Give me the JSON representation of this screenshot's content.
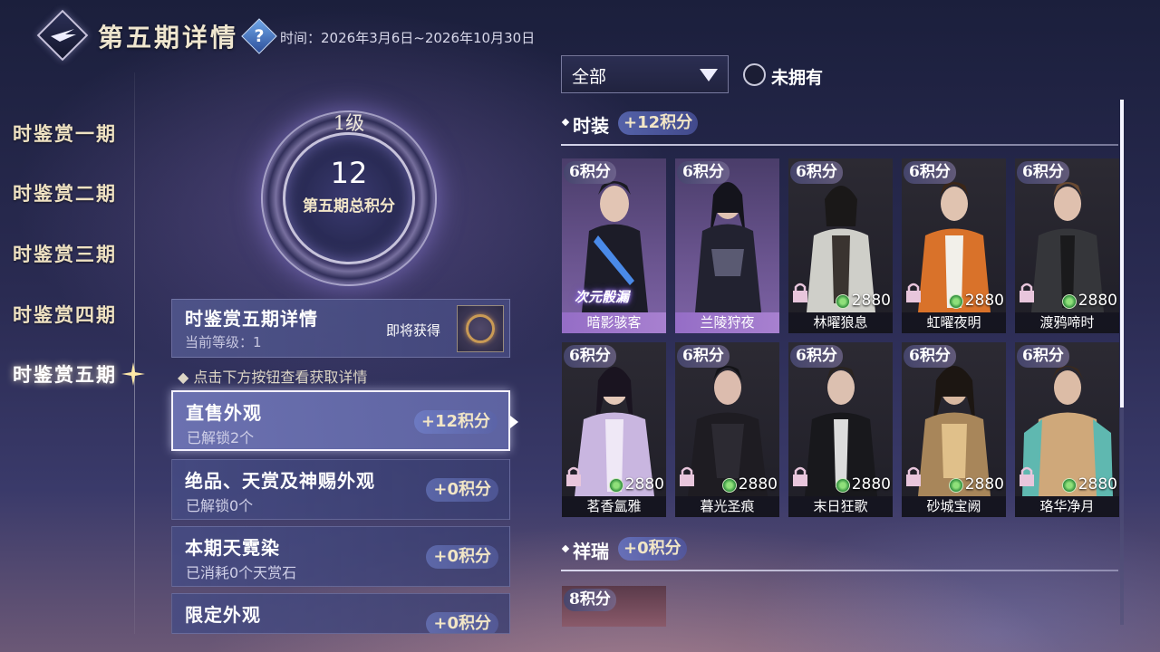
{
  "header": {
    "title": "第五期详情",
    "help_label": "?",
    "time_label": "时间：",
    "time_range": "2026年3月6日~2026年10月30日"
  },
  "nav": {
    "items": [
      {
        "label": "时鉴赏一期"
      },
      {
        "label": "时鉴赏二期"
      },
      {
        "label": "时鉴赏三期"
      },
      {
        "label": "时鉴赏四期"
      },
      {
        "label": "时鉴赏五期",
        "active": true
      }
    ]
  },
  "progress": {
    "level": "1级",
    "score": "12",
    "score_label": "第五期总积分"
  },
  "detail": {
    "title": "时鉴赏五期详情",
    "current_level": "当前等级：1",
    "soon_label": "即将获得"
  },
  "hint": "◆ 点击下方按钮查看获取详情",
  "categories": [
    {
      "title": "直售外观",
      "sub": "已解锁2个",
      "badge": "+12积分",
      "selected": true
    },
    {
      "title": "绝品、天赏及神赐外观",
      "sub": "已解锁0个",
      "badge": "+0积分"
    },
    {
      "title": "本期天霓染",
      "sub": "已消耗0个天赏石",
      "badge": "+0积分"
    },
    {
      "title": "限定外观",
      "sub": "",
      "badge": "+0积分"
    }
  ],
  "filter": {
    "selected": "全部",
    "unowned_label": "未拥有"
  },
  "sections": {
    "fashion": {
      "title": "时装",
      "badge": "+12积分"
    },
    "xiangrui": {
      "title": "祥瑞",
      "badge": "+0积分"
    }
  },
  "items": [
    {
      "points": "6积分",
      "name": "暗影骇客",
      "owned": true,
      "tag": "次元骰漏"
    },
    {
      "points": "6积分",
      "name": "兰陵狩夜",
      "owned": true
    },
    {
      "points": "6积分",
      "name": "林曜狼息",
      "price": "2880"
    },
    {
      "points": "6积分",
      "name": "虹曜夜明",
      "price": "2880"
    },
    {
      "points": "6积分",
      "name": "渡鸦啼时",
      "price": "2880"
    },
    {
      "points": "6积分",
      "name": "茗香氲雅",
      "price": "2880"
    },
    {
      "points": "6积分",
      "name": "暮光圣痕",
      "price": "2880"
    },
    {
      "points": "6积分",
      "name": "末日狂歌",
      "price": "2880"
    },
    {
      "points": "6积分",
      "name": "砂城宝阙",
      "price": "2880"
    },
    {
      "points": "6积分",
      "name": "珞华净月",
      "price": "2880"
    }
  ],
  "xiangrui_items": [
    {
      "points": "8积分"
    }
  ],
  "colors": {
    "accent_gold": "#efe2c2",
    "badge_text": "#f2e6c6",
    "panel_bg": "#464a80"
  }
}
